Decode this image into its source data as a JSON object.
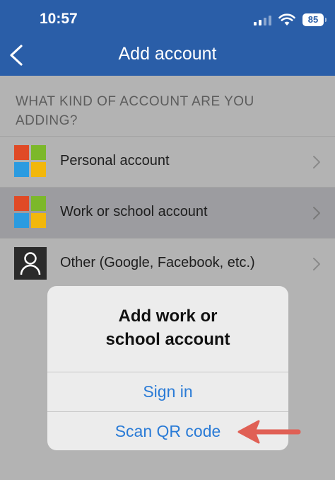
{
  "status_bar": {
    "time": "10:57",
    "battery": "85"
  },
  "nav": {
    "title": "Add account"
  },
  "section": {
    "header": "WHAT KIND OF ACCOUNT ARE YOU ADDING?"
  },
  "rows": [
    {
      "label": "Personal account"
    },
    {
      "label": "Work or school account"
    },
    {
      "label": "Other (Google, Facebook, etc.)"
    }
  ],
  "dialog": {
    "title_line1": "Add work or",
    "title_line2": "school account",
    "sign_in": "Sign in",
    "scan_qr": "Scan QR code"
  },
  "colors": {
    "header_bg": "#2a5ea8",
    "accent": "#2a7bd6",
    "arrow": "#e06055",
    "ms_red": "#e04a26",
    "ms_green": "#7cb82a",
    "ms_blue": "#2b9be0",
    "ms_yellow": "#f2b70c"
  },
  "icons": {
    "back": "chevron-left-icon",
    "row_chevron": "chevron-right-icon",
    "microsoft": "microsoft-logo-icon",
    "other": "person-icon"
  }
}
